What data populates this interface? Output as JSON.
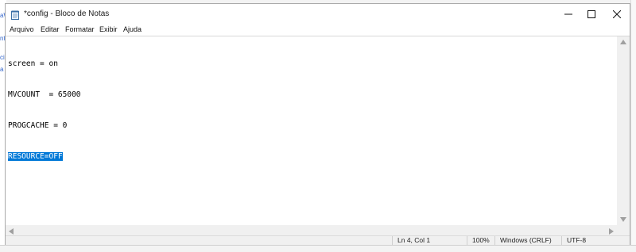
{
  "background": {
    "fragments": [
      "aWiki",
      "nt",
      "ci",
      "a"
    ]
  },
  "window": {
    "title": "*config - Bloco de Notas",
    "icon": "notepad-icon",
    "controls": {
      "minimize": "minimize-icon",
      "maximize": "maximize-icon",
      "close": "close-icon"
    }
  },
  "menu": [
    "Arquivo",
    "Editar",
    "Formatar",
    "Exibir",
    "Ajuda"
  ],
  "editor": {
    "lines": [
      "screen = on",
      "MVCOUNT  = 65000",
      "PROGCACHE = 0",
      "RESOURCE=OFF"
    ],
    "selected_line_index": 3,
    "selection_color": "#0078d7"
  },
  "status": {
    "position": "Ln 4, Col 1",
    "zoom": "100%",
    "line_ending": "Windows (CRLF)",
    "encoding": "UTF-8"
  }
}
